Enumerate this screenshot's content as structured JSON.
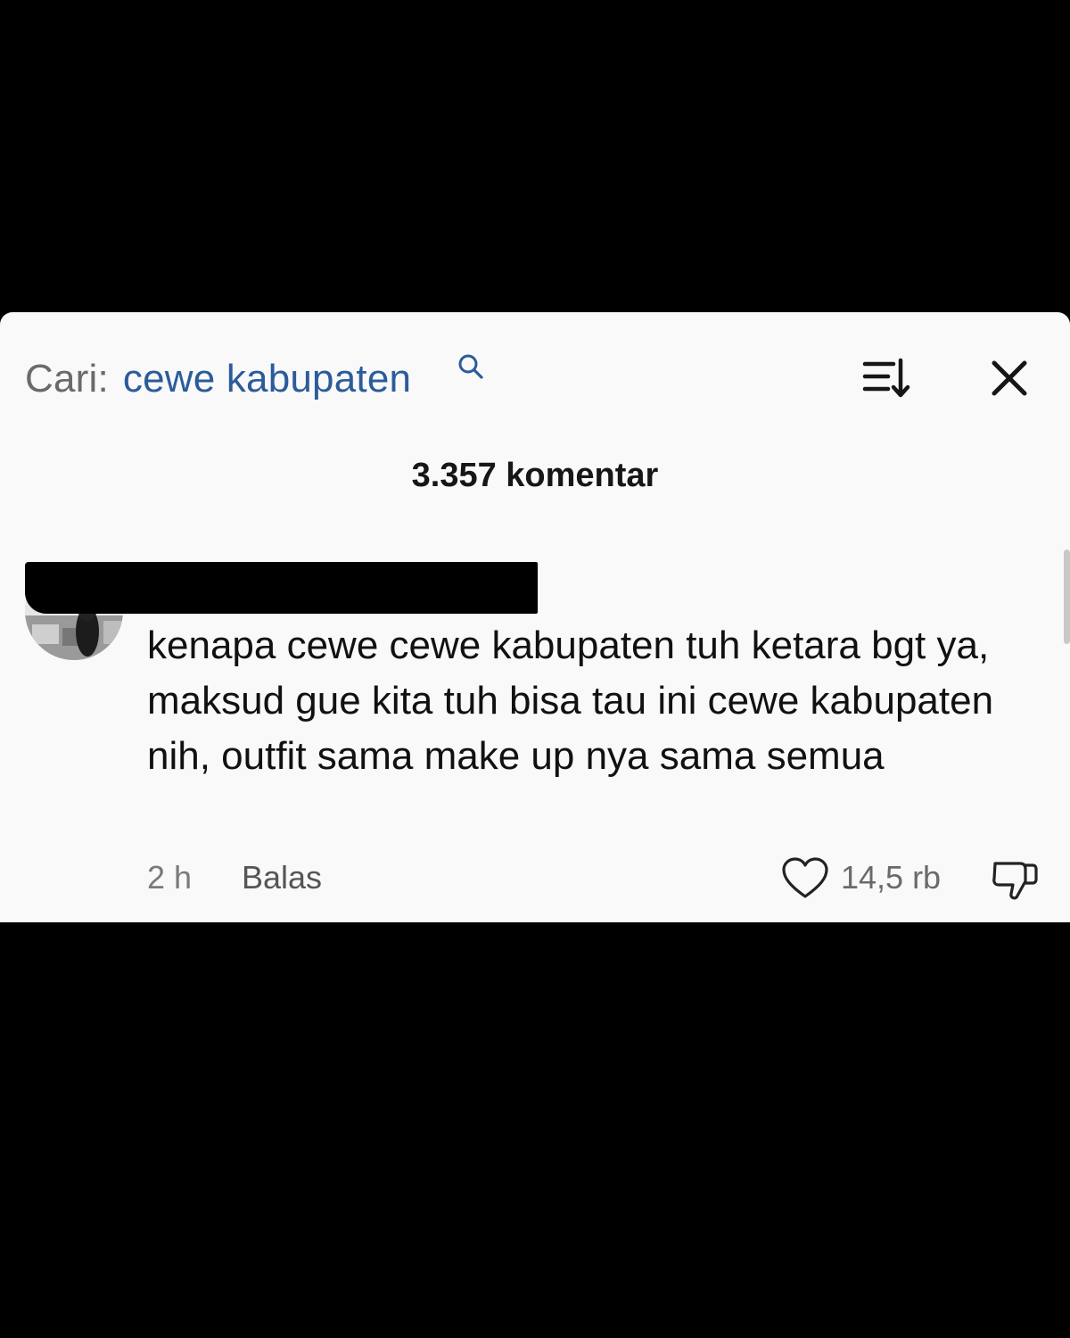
{
  "search": {
    "prefix": "Cari:",
    "query": "cewe kabupaten"
  },
  "header": {
    "comment_count": "3.357 komentar"
  },
  "comment": {
    "text": "kenapa cewe cewe kabupaten tuh ketara bgt ya, maksud gue kita tuh bisa tau ini cewe kabupaten nih, outfit sama make up nya sama semua",
    "time": "2 h",
    "reply_label": "Balas",
    "like_count": "14,5 rb"
  },
  "icons": {
    "search": "search-icon",
    "sort": "sort-icon",
    "close": "close-icon",
    "like": "heart-icon",
    "dislike": "thumbs-down-icon"
  },
  "colors": {
    "panel_background": "#f9f9f9",
    "page_background": "#000000",
    "search_query": "#2b5c9a"
  }
}
